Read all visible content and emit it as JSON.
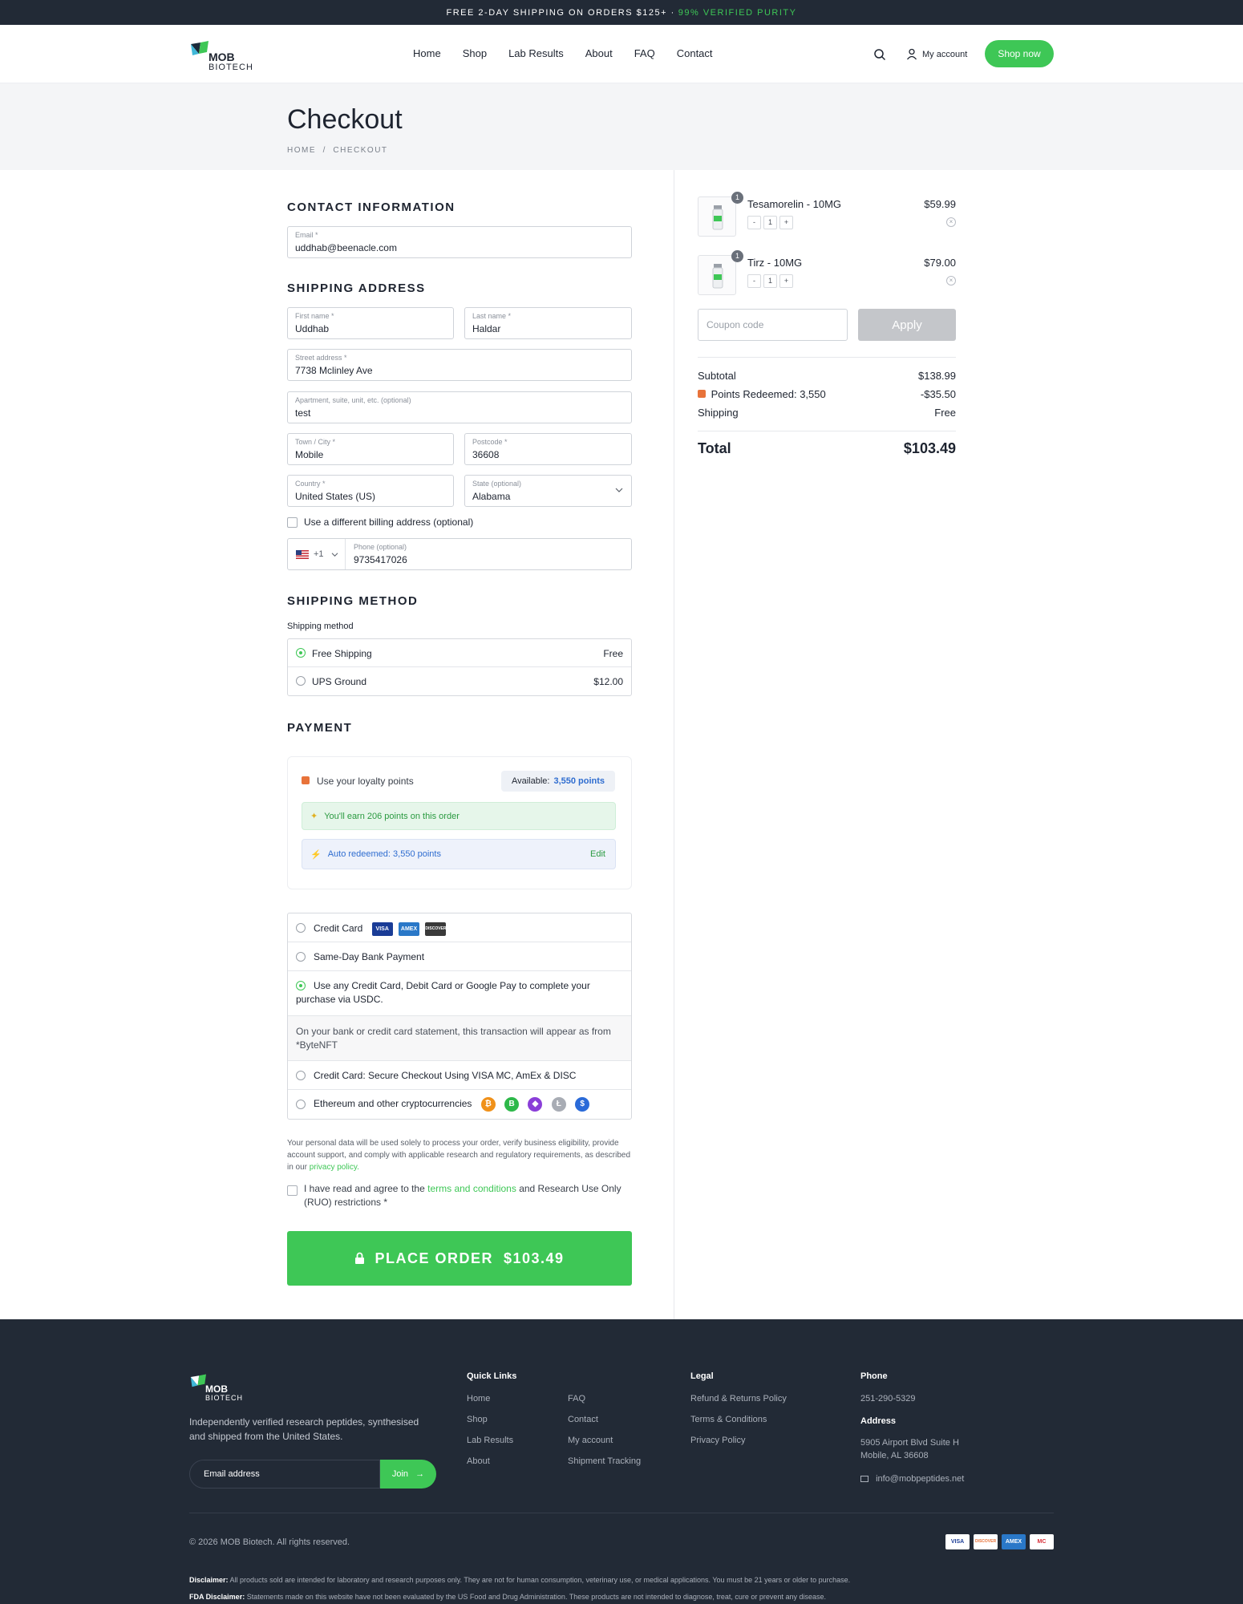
{
  "topbar": {
    "text": "FREE 2-DAY SHIPPING ON ORDERS $125+ ·",
    "highlight": "99% VERIFIED PURITY"
  },
  "brand": {
    "line1": "MOB",
    "line2": "BIOTECH"
  },
  "nav": [
    "Home",
    "Shop",
    "Lab Results",
    "About",
    "FAQ",
    "Contact"
  ],
  "header": {
    "account": "My account",
    "cta": "Shop now"
  },
  "page": {
    "title": "Checkout",
    "breadcrumb_home": "HOME",
    "breadcrumb_sep": "/",
    "breadcrumb_current": "CHECKOUT"
  },
  "contact": {
    "title": "CONTACT INFORMATION",
    "email_label": "Email *",
    "email_value": "uddhab@beenacle.com"
  },
  "shipping": {
    "title": "SHIPPING ADDRESS",
    "first_label": "First name *",
    "first_value": "Uddhab",
    "last_label": "Last name *",
    "last_value": "Haldar",
    "street_label": "Street address *",
    "street_value": "7738 Mclinley Ave",
    "apt_label": "Apartment, suite, unit, etc. (optional)",
    "apt_value": "test",
    "town_label": "Town / City *",
    "town_value": "Mobile",
    "post_label": "Postcode *",
    "post_value": "36608",
    "country_label": "Country *",
    "country_value": "United States (US)",
    "state_label": "State (optional)",
    "state_value": "Alabama",
    "billing_label": "Use a different billing address (optional)",
    "phone_code": "+1",
    "phone_label": "Phone (optional)",
    "phone_value": "9735417026"
  },
  "method": {
    "title": "SHIPPING METHOD",
    "subtitle": "Shipping method",
    "options": [
      {
        "label": "Free Shipping",
        "price": "Free",
        "selected": true
      },
      {
        "label": "UPS Ground",
        "price": "$12.00",
        "selected": false
      }
    ]
  },
  "payment": {
    "title": "PAYMENT",
    "loyalty_label": "Use your loyalty points",
    "available_label": "Available:",
    "available_value": "3,550 points",
    "earn_text": "You'll earn 206 points on this order",
    "redeem_text": "Auto redeemed: 3,550 points",
    "edit_label": "Edit",
    "methods": {
      "credit_card": "Credit Card",
      "bank": "Same-Day Bank Payment",
      "usdc": "Use any Credit Card, Debit Card or Google Pay to complete your purchase via USDC.",
      "note": "On your bank or credit card statement, this transaction will appear as from *ByteNFT",
      "secure": "Credit Card: Secure Checkout Using VISA MC, AmEx & DISC",
      "crypto": "Ethereum and other cryptocurrencies"
    },
    "card_logos": [
      "VISA",
      "AMEX",
      "DISCOVER"
    ],
    "coins": [
      "₿",
      "B",
      "◆",
      "Ł",
      "$"
    ],
    "privacy_text": "Your personal data will be used solely to process your order, verify business eligibility, provide account support, and comply with applicable research and regulatory requirements, as described in our",
    "privacy_link": "privacy policy.",
    "agree_pre": "I have read and agree to the",
    "agree_link": "terms and conditions",
    "agree_post": "and Research Use Only (RUO) restrictions *",
    "place_order": "PLACE ORDER  $103.49"
  },
  "cart": {
    "items": [
      {
        "name": "Tesamorelin - 10MG",
        "price": "$59.99",
        "qty": "1"
      },
      {
        "name": "Tirz - 10MG",
        "price": "$79.00",
        "qty": "1"
      }
    ],
    "coupon_placeholder": "Coupon code",
    "apply_label": "Apply",
    "subtotal_label": "Subtotal",
    "subtotal_value": "$138.99",
    "points_label": "Points Redeemed: 3,550",
    "points_value": "-$35.50",
    "shipping_label": "Shipping",
    "shipping_value": "Free",
    "total_label": "Total",
    "total_value": "$103.49"
  },
  "footer": {
    "tagline": "Independently verified research peptides, synthesised and shipped from the United States.",
    "newsletter_placeholder": "Email address",
    "join_label": "Join",
    "quick_title": "Quick Links",
    "quick_col1": [
      "Home",
      "Shop",
      "Lab Results",
      "About"
    ],
    "quick_col2": [
      "FAQ",
      "Contact",
      "My account",
      "Shipment Tracking"
    ],
    "legal_title": "Legal",
    "legal": [
      "Refund & Returns Policy",
      "Terms & Conditions",
      "Privacy Policy"
    ],
    "phone_title": "Phone",
    "phone": "251-290-5329",
    "address_title": "Address",
    "address1": "5905 Airport Blvd Suite H",
    "address2": "Mobile, AL 36608",
    "email": "info@mobpeptides.net",
    "copyright": "© 2026 MOB Biotech. All rights reserved.",
    "cards": [
      "VISA",
      "DISCOVER",
      "AMEX",
      "MC"
    ],
    "disclaimer_label": "Disclaimer:",
    "disclaimer_text": "All products sold are intended for laboratory and research purposes only. They are not for human consumption, veterinary use, or medical applications. You must be 21 years or older to purchase.",
    "fda_label": "FDA Disclaimer:",
    "fda_text": "Statements made on this website have not been evaluated by the US Food and Drug Administration. These products are not intended to diagnose, treat, cure or prevent any disease."
  },
  "colors": {
    "accent": "#3ec756",
    "dark": "#222a36",
    "link_blue": "#2f6dd0"
  }
}
